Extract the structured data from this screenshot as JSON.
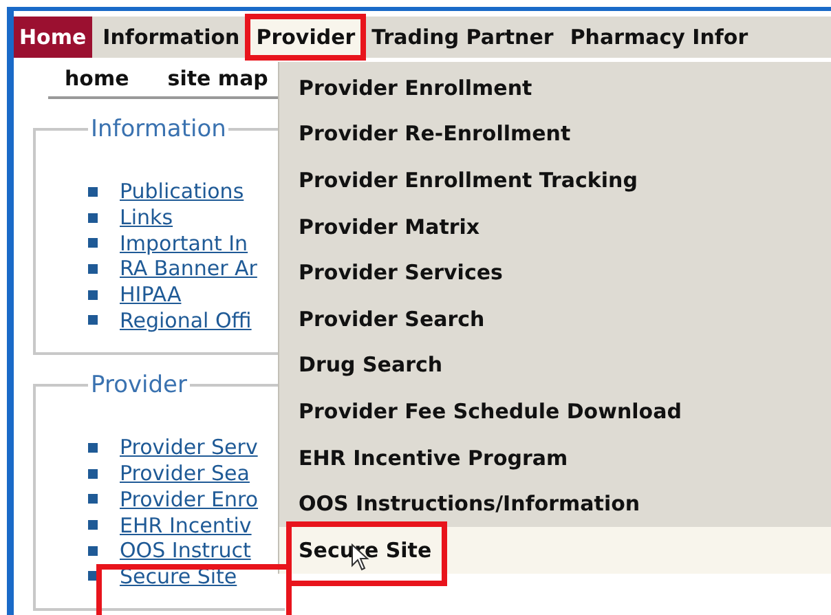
{
  "top_menu": [
    {
      "label": "Home",
      "selected": true,
      "expanded": false,
      "annotated": false
    },
    {
      "label": "Information",
      "selected": false,
      "expanded": false,
      "annotated": false
    },
    {
      "label": "Provider",
      "selected": false,
      "expanded": true,
      "annotated": true
    },
    {
      "label": "Trading Partner",
      "selected": false,
      "expanded": false,
      "annotated": false
    },
    {
      "label": "Pharmacy Infor",
      "selected": false,
      "expanded": false,
      "annotated": false
    }
  ],
  "sub_nav": [
    "home",
    "site map"
  ],
  "sections": [
    {
      "title": "Information",
      "links": [
        {
          "label": "Publications",
          "annotated": false
        },
        {
          "label": "Links",
          "annotated": false
        },
        {
          "label": "Important In",
          "annotated": false
        },
        {
          "label": "RA Banner Ar",
          "annotated": false
        },
        {
          "label": "HIPAA",
          "annotated": false
        },
        {
          "label": "Regional Offi",
          "annotated": false
        }
      ]
    },
    {
      "title": "Provider",
      "links": [
        {
          "label": "Provider Serv",
          "annotated": false
        },
        {
          "label": "Provider Sea",
          "annotated": false
        },
        {
          "label": "Provider Enro",
          "annotated": false
        },
        {
          "label": "EHR Incentiv",
          "annotated": false
        },
        {
          "label": "OOS Instruct",
          "annotated": false
        },
        {
          "label": "Secure Site",
          "annotated": true
        }
      ]
    }
  ],
  "dropdown": {
    "items": [
      {
        "label": "Provider Enrollment",
        "selected": false,
        "annotated": false
      },
      {
        "label": "Provider Re-Enrollment",
        "selected": false,
        "annotated": false
      },
      {
        "label": "Provider Enrollment Tracking",
        "selected": false,
        "annotated": false
      },
      {
        "label": "Provider Matrix",
        "selected": false,
        "annotated": false
      },
      {
        "label": "Provider Services",
        "selected": false,
        "annotated": false
      },
      {
        "label": "Provider Search",
        "selected": false,
        "annotated": false
      },
      {
        "label": "Drug Search",
        "selected": false,
        "annotated": false
      },
      {
        "label": "Provider Fee Schedule Download",
        "selected": false,
        "annotated": false
      },
      {
        "label": "EHR Incentive Program",
        "selected": false,
        "annotated": false
      },
      {
        "label": "OOS Instructions/Information",
        "selected": false,
        "annotated": false
      },
      {
        "label": "Secure Site",
        "selected": true,
        "annotated": true
      }
    ]
  }
}
